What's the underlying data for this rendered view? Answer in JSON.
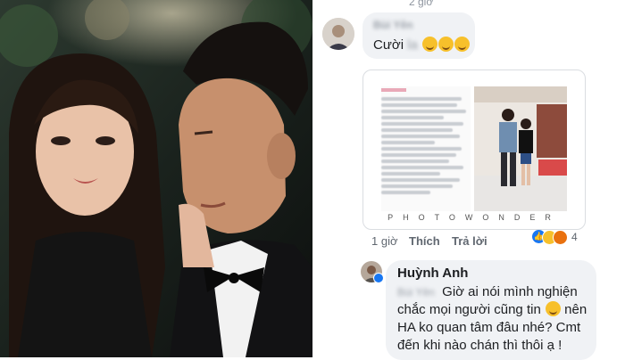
{
  "header": {
    "timestamp": "2 giờ"
  },
  "first_comment": {
    "author_blurred": "Bùi Yên",
    "text": "Cười ",
    "blurred_tag": "la",
    "emoji_count": 3
  },
  "image_card": {
    "watermark": "PHOTOWONDER"
  },
  "first_comment_actions": {
    "time": "1 giờ",
    "like": "Thích",
    "reply": "Trả lời",
    "reaction_count": "4"
  },
  "reply": {
    "author": "Huỳnh Anh",
    "mention_blurred": "Bùi Yên",
    "text_line1": "Giờ ai nói mình nghiện",
    "text_line2_a": "chắc mọi người cũng tin ",
    "text_line2_b": " nên",
    "text_line3": "HA ko quan tâm đâu nhé? Cmt",
    "text_line4": "đến khi nào chán thì thôi ạ !"
  }
}
